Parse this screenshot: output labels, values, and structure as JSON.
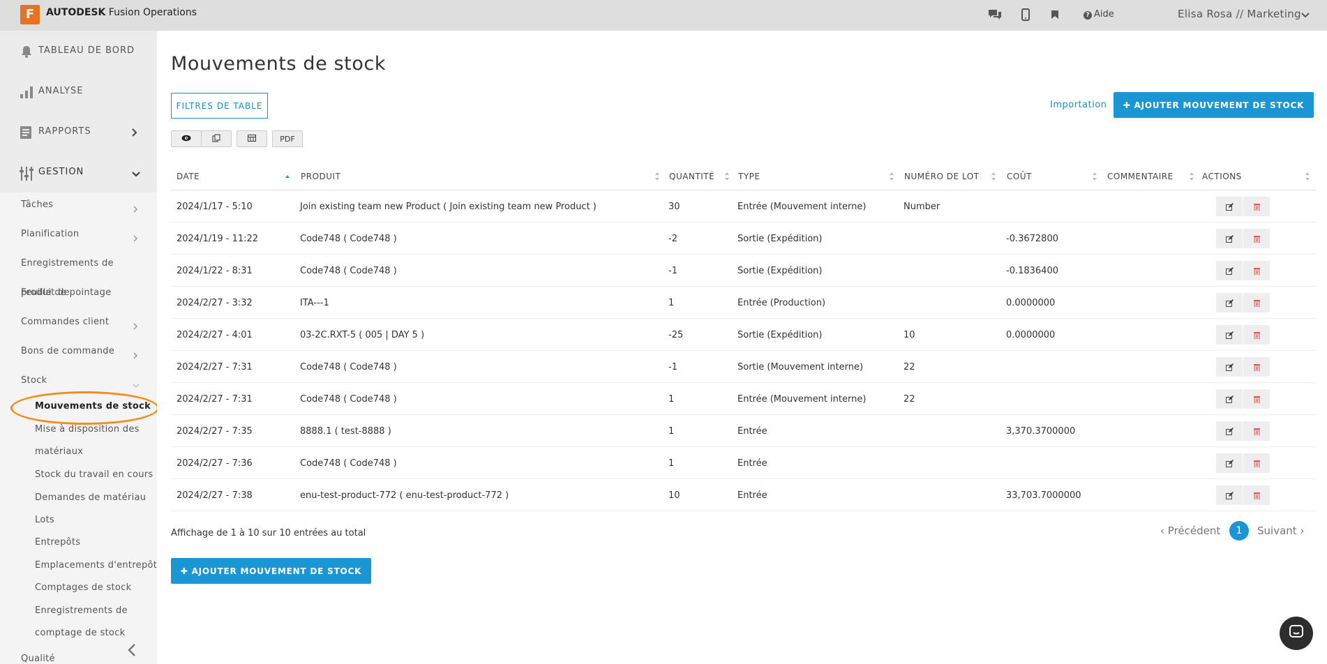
{
  "topbar": {
    "logo_letter": "F",
    "brand_bold": "AUTODESK",
    "brand_rest": " Fusion Operations",
    "help_label": "Aide",
    "user_label": "Elisa Rosa // Marketing"
  },
  "sidebar": {
    "main": [
      {
        "label": "TABLEAU DE BORD",
        "icon": "bell-icon"
      },
      {
        "label": "ANALYSE",
        "icon": "bar-chart-icon"
      },
      {
        "label": "RAPPORTS",
        "icon": "report-icon"
      },
      {
        "label": "GESTION",
        "icon": "sliders-icon"
      }
    ],
    "sub": [
      {
        "label": "Tâches"
      },
      {
        "label": "Planification"
      },
      {
        "label": "Enregistrements de"
      },
      {
        "label": "produit de"
      },
      {
        "label": "Feuille de pointage"
      },
      {
        "label": "Commandes client"
      },
      {
        "label": "Bons de commande"
      },
      {
        "label": "Stock"
      },
      {
        "label": "Qualité"
      }
    ],
    "leaves": [
      "Mouvements de stock",
      "Mise à disposition des",
      "matériaux",
      "Stock du travail en cours",
      "Demandes de matériau",
      "Lots",
      "Entrepôts",
      "Emplacements d'entrepôt",
      "Comptages de stock",
      "Enregistrements de",
      "comptage de stock"
    ]
  },
  "main": {
    "title": "Mouvements de stock",
    "filters_button": "FILTRES DE TABLE",
    "import_link": "Importation",
    "add_button": "AJOUTER MOUVEMENT DE STOCK",
    "toolbar": {
      "pdf": "PDF"
    },
    "columns": [
      "DATE",
      "PRODUIT",
      "QUANTITÉ",
      "TYPE",
      "NUMÉRO DE LOT",
      "COÛT",
      "COMMENTAIRE",
      "ACTIONS"
    ],
    "rows": [
      {
        "date": "2024/1/17 - 5:10",
        "product": "Join existing team new Product ( Join existing team new Product )",
        "qty": "30",
        "type": "Entrée (Mouvement interne)",
        "lot": "Number",
        "cost": "",
        "comment": ""
      },
      {
        "date": "2024/1/19 - 11:22",
        "product": "Code748 ( Code748 )",
        "qty": "-2",
        "type": "Sortie (Expédition)",
        "lot": "",
        "cost": "-0.3672800",
        "comment": ""
      },
      {
        "date": "2024/1/22 - 8:31",
        "product": "Code748 ( Code748 )",
        "qty": "-1",
        "type": "Sortie (Expédition)",
        "lot": "",
        "cost": "-0.1836400",
        "comment": ""
      },
      {
        "date": "2024/2/27 - 3:32",
        "product": "ITA---1",
        "qty": "1",
        "type": "Entrée (Production)",
        "lot": "",
        "cost": "0.0000000",
        "comment": ""
      },
      {
        "date": "2024/2/27 - 4:01",
        "product": "03-2C.RXT-5 ( 005 | DAY 5 )",
        "qty": "-25",
        "type": "Sortie (Expédition)",
        "lot": "10",
        "cost": "0.0000000",
        "comment": ""
      },
      {
        "date": "2024/2/27 - 7:31",
        "product": "Code748 ( Code748 )",
        "qty": "-1",
        "type": "Sortie (Mouvement interne)",
        "lot": "22",
        "cost": "",
        "comment": ""
      },
      {
        "date": "2024/2/27 - 7:31",
        "product": "Code748 ( Code748 )",
        "qty": "1",
        "type": "Entrée (Mouvement interne)",
        "lot": "22",
        "cost": "",
        "comment": ""
      },
      {
        "date": "2024/2/27 - 7:35",
        "product": "8888.1 ( test-8888 )",
        "qty": "1",
        "type": "Entrée",
        "lot": "",
        "cost": "3,370.3700000",
        "comment": ""
      },
      {
        "date": "2024/2/27 - 7:36",
        "product": "Code748 ( Code748 )",
        "qty": "1",
        "type": "Entrée",
        "lot": "",
        "cost": "",
        "comment": ""
      },
      {
        "date": "2024/2/27 - 7:38",
        "product": "enu-test-product-772 ( enu-test-product-772 )",
        "qty": "10",
        "type": "Entrée",
        "lot": "",
        "cost": "33,703.7000000",
        "comment": ""
      }
    ],
    "summary": "Affichage de 1 à 10 sur 10 entrées au total",
    "pagination": {
      "prev": "Précédent",
      "current": "1",
      "next": "Suivant"
    }
  },
  "colors": {
    "accent": "#1a96d4",
    "highlight": "#f28c1e",
    "delete": "#e05a5a"
  }
}
